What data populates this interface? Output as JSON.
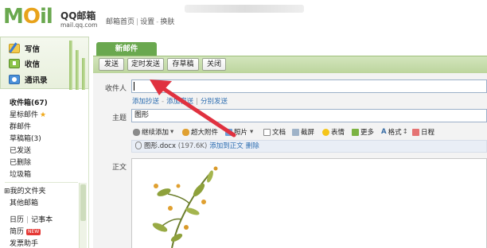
{
  "header": {
    "logo_text": "MOil",
    "logo_brand": "QQ邮箱",
    "logo_domain": "mail.qq.com",
    "links": [
      "邮箱首页",
      "设置",
      "换肤"
    ]
  },
  "sidebar": {
    "actions": [
      {
        "label": "写信",
        "icon": "pen-icon"
      },
      {
        "label": "收信",
        "icon": "inbox-download-icon"
      },
      {
        "label": "通讯录",
        "icon": "address-book-icon"
      }
    ],
    "folders": {
      "inbox": "收件箱(67)",
      "starred": "星标邮件",
      "group": "群邮件",
      "drafts": "草稿箱(3)",
      "sent": "已发送",
      "deleted": "已删除",
      "trash": "垃圾箱",
      "my_folders": "我的文件夹",
      "other": "其他邮箱",
      "calendar": "日历",
      "notes": "记事本",
      "resume": "简历",
      "resume_badge": "NEW",
      "invoice": "发票助手"
    }
  },
  "compose": {
    "tab_label": "新邮件",
    "toolbar": [
      "发送",
      "定时发送",
      "存草稿",
      "关闭"
    ],
    "to_label": "收件人",
    "to_value": "",
    "to_links": [
      "添加抄送",
      "添加密送",
      "分别发送"
    ],
    "subject_label": "主题",
    "subject_value": "图形",
    "format_bar": [
      "继续添加",
      "超大附件",
      "照片",
      "文档",
      "截屏",
      "表情",
      "更多",
      "格式",
      "日程"
    ],
    "attachment": {
      "name": "图形.docx",
      "size": "(197.6K)",
      "insert": "添加到正文",
      "delete": "删除"
    },
    "body_label": "正文"
  },
  "colors": {
    "accent_green": "#6aa84f",
    "toolbar_green": "#c6dcaa",
    "link_blue": "#2b6cb0",
    "annotation_arrow": "#e0313f"
  }
}
